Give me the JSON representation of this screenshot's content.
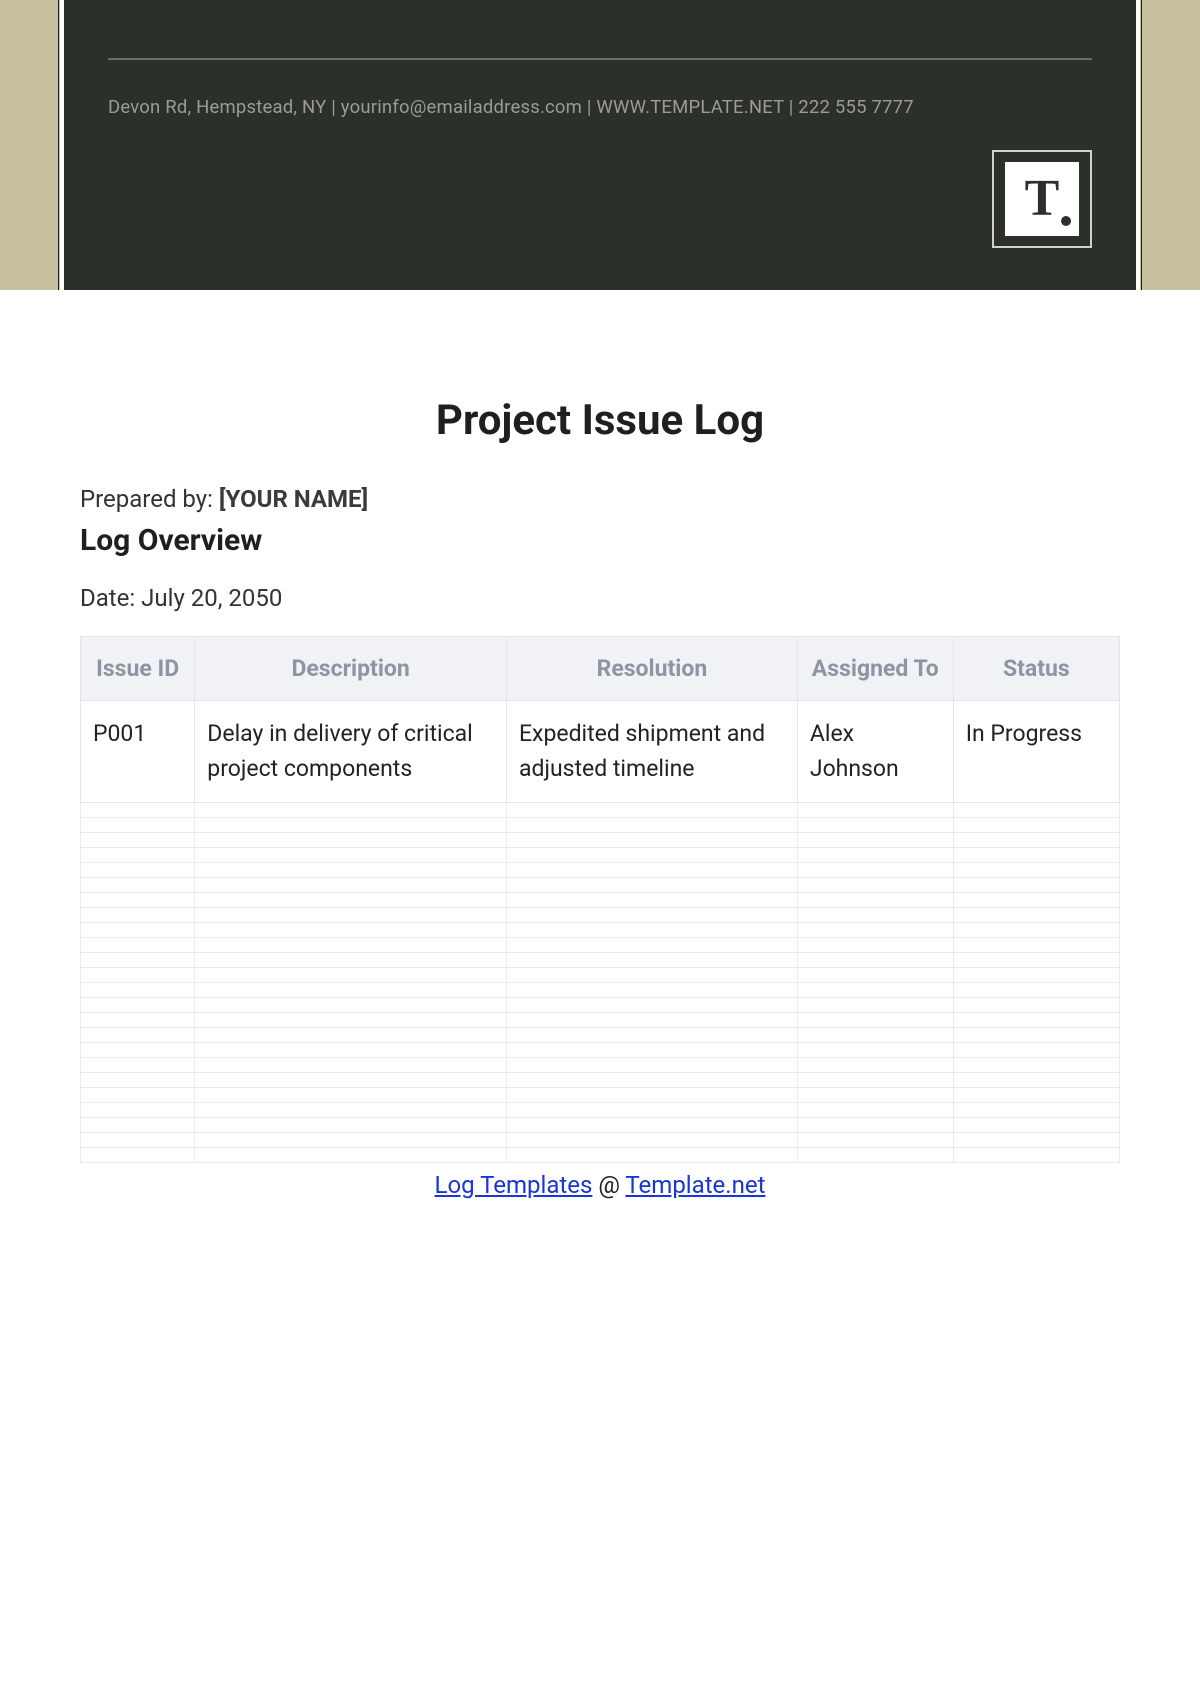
{
  "header": {
    "contact_line": "Devon Rd, Hempstead, NY | yourinfo@emailaddress.com | WWW.TEMPLATE.NET | 222 555 7777",
    "logo_letter": "T"
  },
  "document": {
    "title": "Project Issue Log",
    "prepared_by_label": "Prepared by: ",
    "prepared_by_value": "[YOUR NAME]",
    "section_heading": "Log Overview",
    "date_label": "Date: ",
    "date_value": "July 20, 2050"
  },
  "table": {
    "columns": [
      "Issue ID",
      "Description",
      "Resolution",
      "Assigned To",
      "Status"
    ],
    "rows": [
      {
        "issue_id": "P001",
        "description": "Delay in delivery of critical project components",
        "resolution": "Expedited shipment and adjusted timeline",
        "assigned_to": "Alex Johnson",
        "status": "In Progress"
      }
    ],
    "blank_row_count": 24
  },
  "footer": {
    "link1_text": "Log Templates",
    "separator": " @ ",
    "link2_text": "Template.net"
  }
}
